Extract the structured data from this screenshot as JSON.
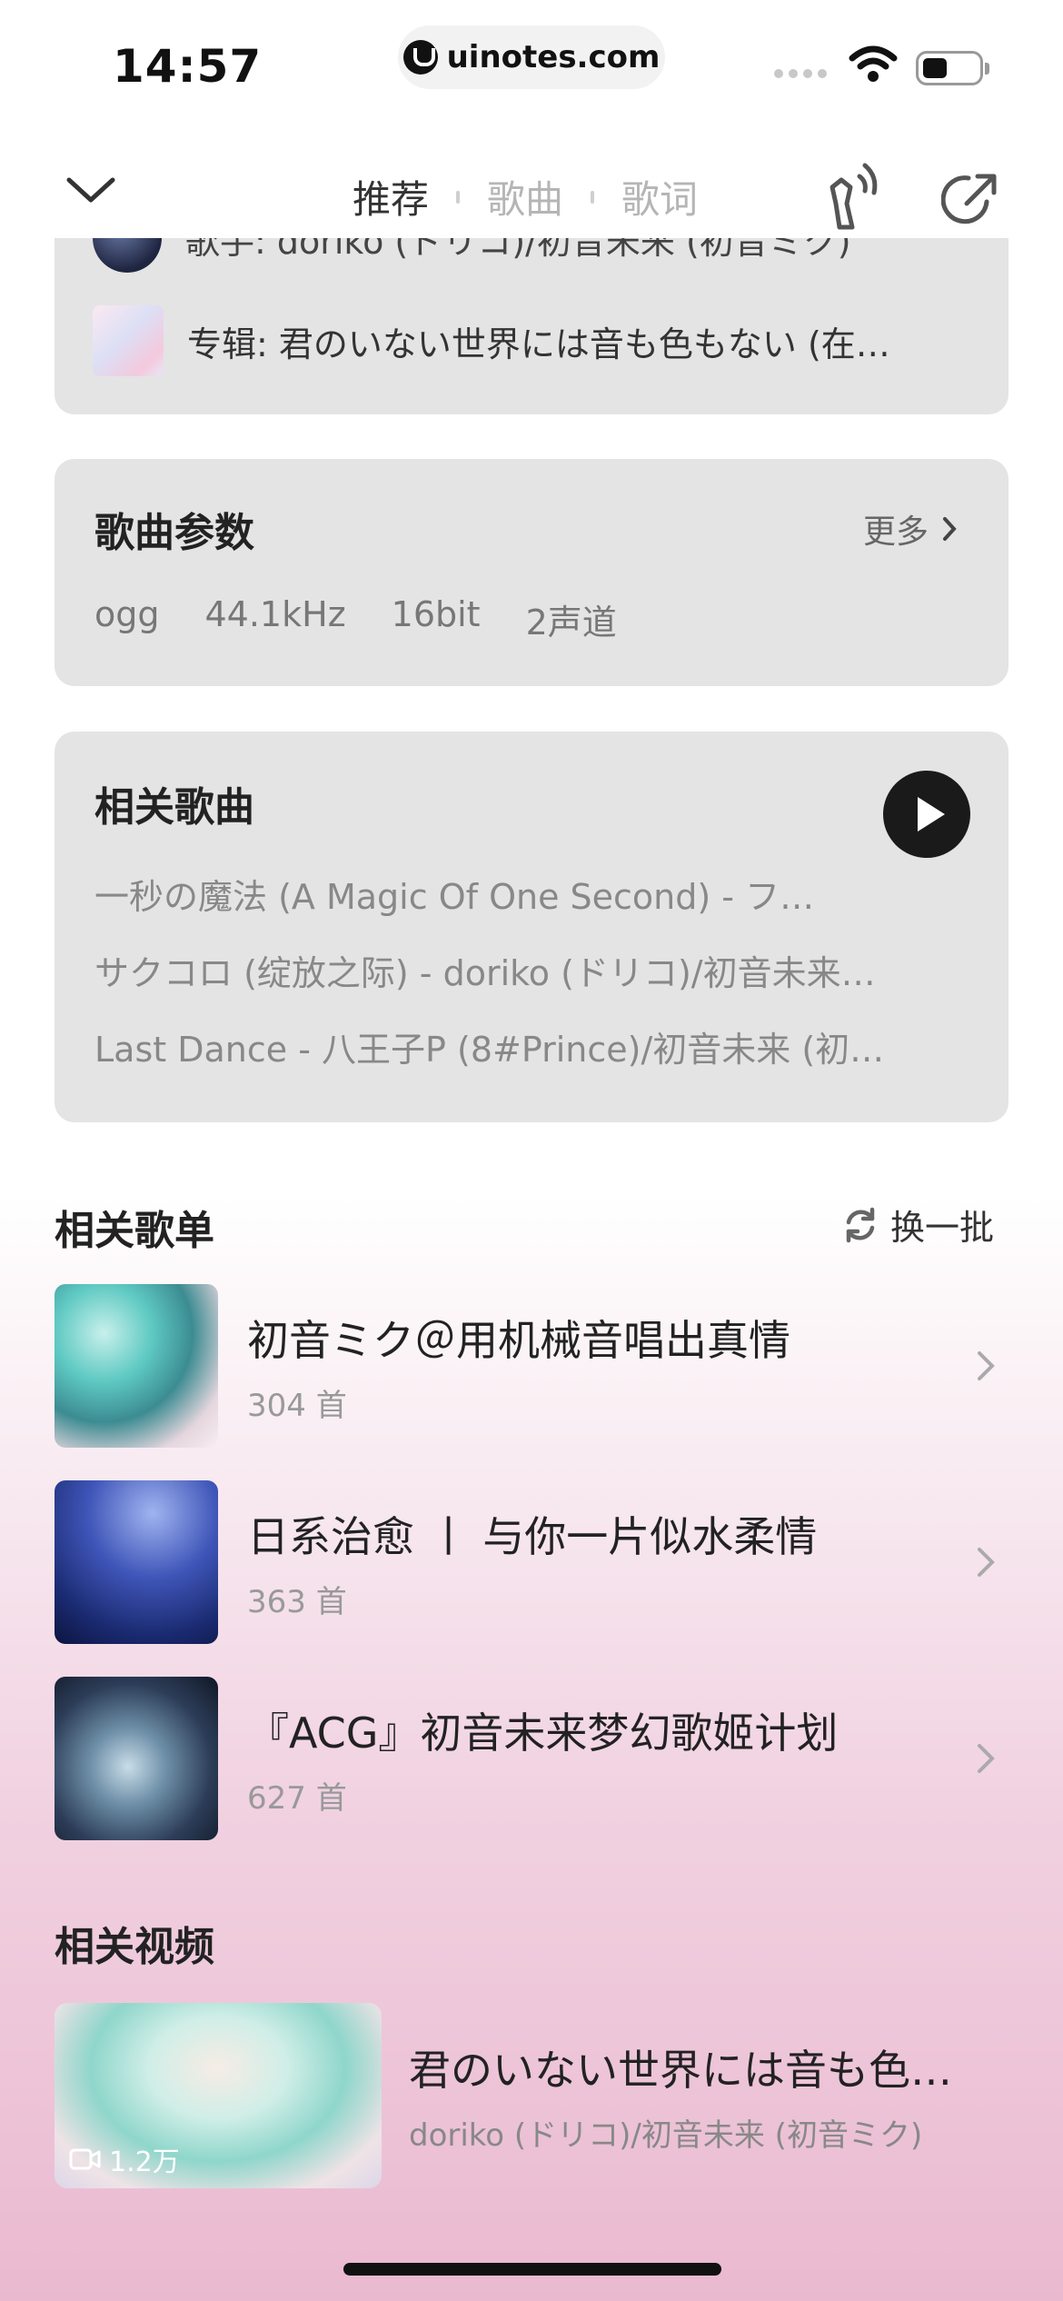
{
  "status_bar": {
    "time": "14:57",
    "url": "uinotes.com"
  },
  "header": {
    "tabs": [
      {
        "label": "推荐",
        "active": true
      },
      {
        "label": "歌曲",
        "active": false
      },
      {
        "label": "歌词",
        "active": false
      }
    ]
  },
  "info_card": {
    "artist": "歌手: doriko (ドリコ)/初音未来 (初音ミク)",
    "album": "专辑: 君のいない世界には音も色もない (在…"
  },
  "params": {
    "title": "歌曲参数",
    "more": "更多",
    "values": [
      "ogg",
      "44.1kHz",
      "16bit",
      "2声道"
    ]
  },
  "related_songs": {
    "title": "相关歌曲",
    "items": [
      "一秒の魔法 (A Magic Of One Second) - フ…",
      "サクコロ (绽放之际) - doriko (ドリコ)/初音未来…",
      "Last Dance - 八王子P (8#Prince)/初音未来 (初…"
    ]
  },
  "related_playlists": {
    "title": "相关歌单",
    "refresh": "换一批",
    "items": [
      {
        "name": "初音ミク＠用机械音唱出真情",
        "count": "304 首"
      },
      {
        "name": "日系治愈 丨 与你一片似水柔情",
        "count": "363 首"
      },
      {
        "name": "『ACG』初音未来梦幻歌姬计划",
        "count": "627 首"
      }
    ]
  },
  "related_videos": {
    "title": "相关视频",
    "items": [
      {
        "name": "君のいない世界には音も色…",
        "artist": "doriko (ドリコ)/初音未来 (初音ミク)",
        "views": "1.2万"
      }
    ]
  },
  "colors": {
    "card_bg": "#e4e4e4",
    "play_button": "#1a1a1a",
    "accent_text": "#222222"
  }
}
